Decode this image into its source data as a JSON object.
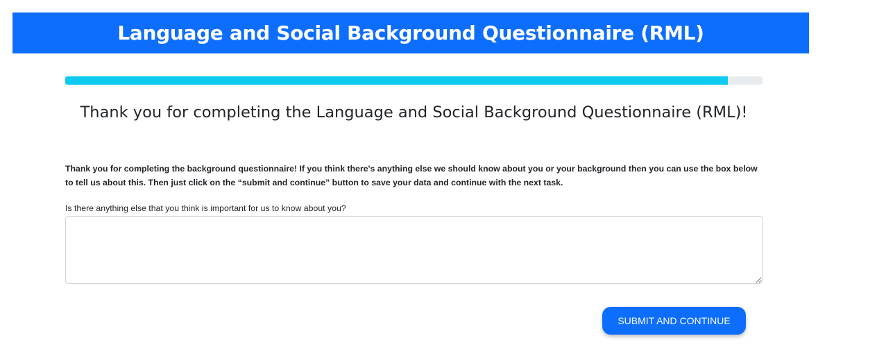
{
  "header": {
    "title": "Language and Social Background Questionnaire (RML)"
  },
  "progress": {
    "percent": 95,
    "color": "#0dcaf0"
  },
  "main": {
    "title": "Thank you for completing the Language and Social Background Questionnaire (RML)!",
    "intro": "Thank you for completing the background questionnaire! If you think there's anything else we should know about you or your background then you can use the box below to tell us about this. Then just click on the “submit and continue” button to save your data and continue with the next task.",
    "question_label": "Is there anything else that you think is important for us to know about you?",
    "answer_value": ""
  },
  "actions": {
    "submit_label": "SUBMIT AND CONTINUE"
  },
  "colors": {
    "brand": "#0d6efd"
  }
}
